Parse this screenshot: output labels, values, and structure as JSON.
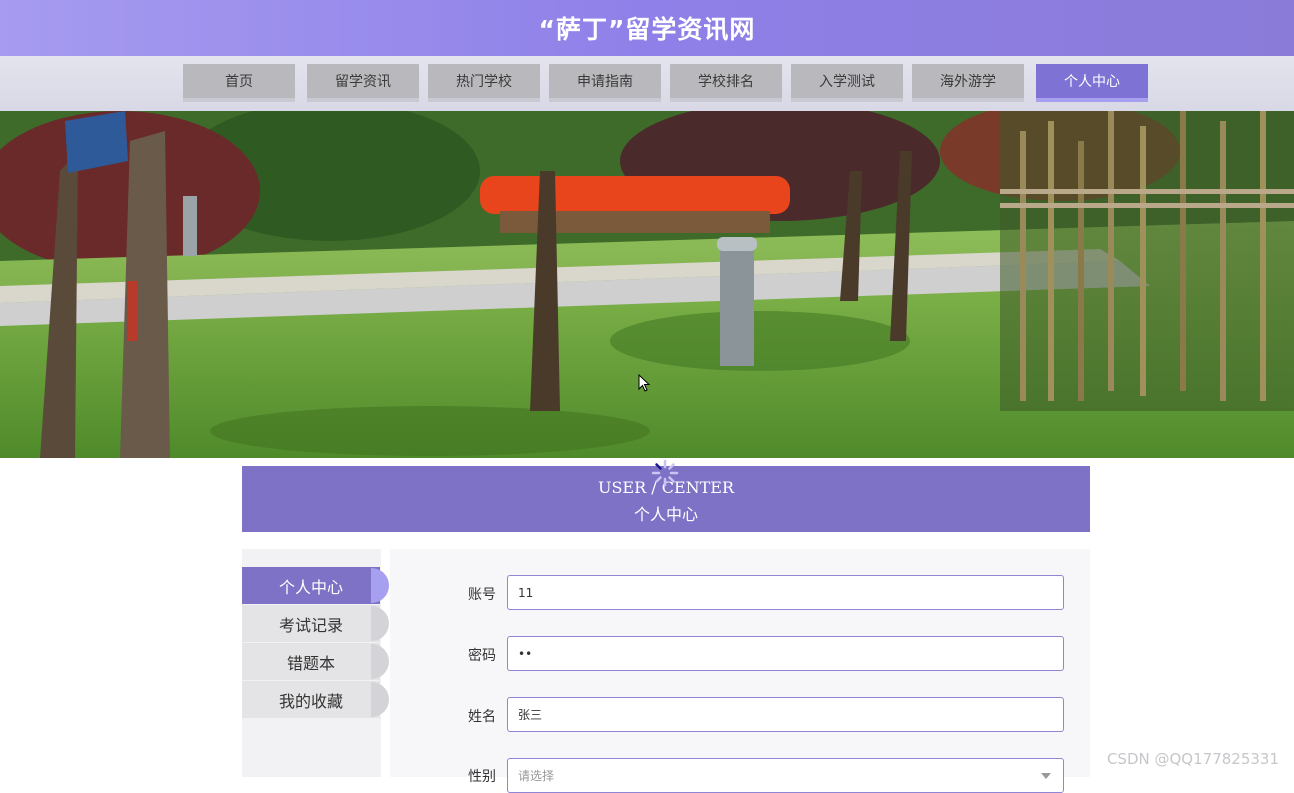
{
  "header": {
    "title": "“萨丁”留学资讯网"
  },
  "nav": {
    "items": [
      {
        "label": "首页"
      },
      {
        "label": "留学资讯"
      },
      {
        "label": "热门学校"
      },
      {
        "label": "申请指南"
      },
      {
        "label": "学校排名"
      },
      {
        "label": "入学测试"
      },
      {
        "label": "海外游学"
      },
      {
        "label": "个人中心"
      }
    ],
    "active_index": 7
  },
  "user_center": {
    "title_en": "USER / CENTER",
    "title_cn": "个人中心"
  },
  "sidebar": {
    "items": [
      {
        "label": "个人中心"
      },
      {
        "label": "考试记录"
      },
      {
        "label": "错题本"
      },
      {
        "label": "我的收藏"
      }
    ],
    "active_index": 0
  },
  "form": {
    "account": {
      "label": "账号",
      "value": "11"
    },
    "password": {
      "label": "密码",
      "value": "••"
    },
    "name": {
      "label": "姓名",
      "value": "张三"
    },
    "gender": {
      "label": "性别",
      "placeholder": "请选择"
    }
  },
  "watermark": "CSDN @QQ177825331",
  "colors": {
    "accent": "#7d72c6",
    "header_gradient_start": "#a69bf0",
    "nav_inactive": "#b9b9bd"
  }
}
